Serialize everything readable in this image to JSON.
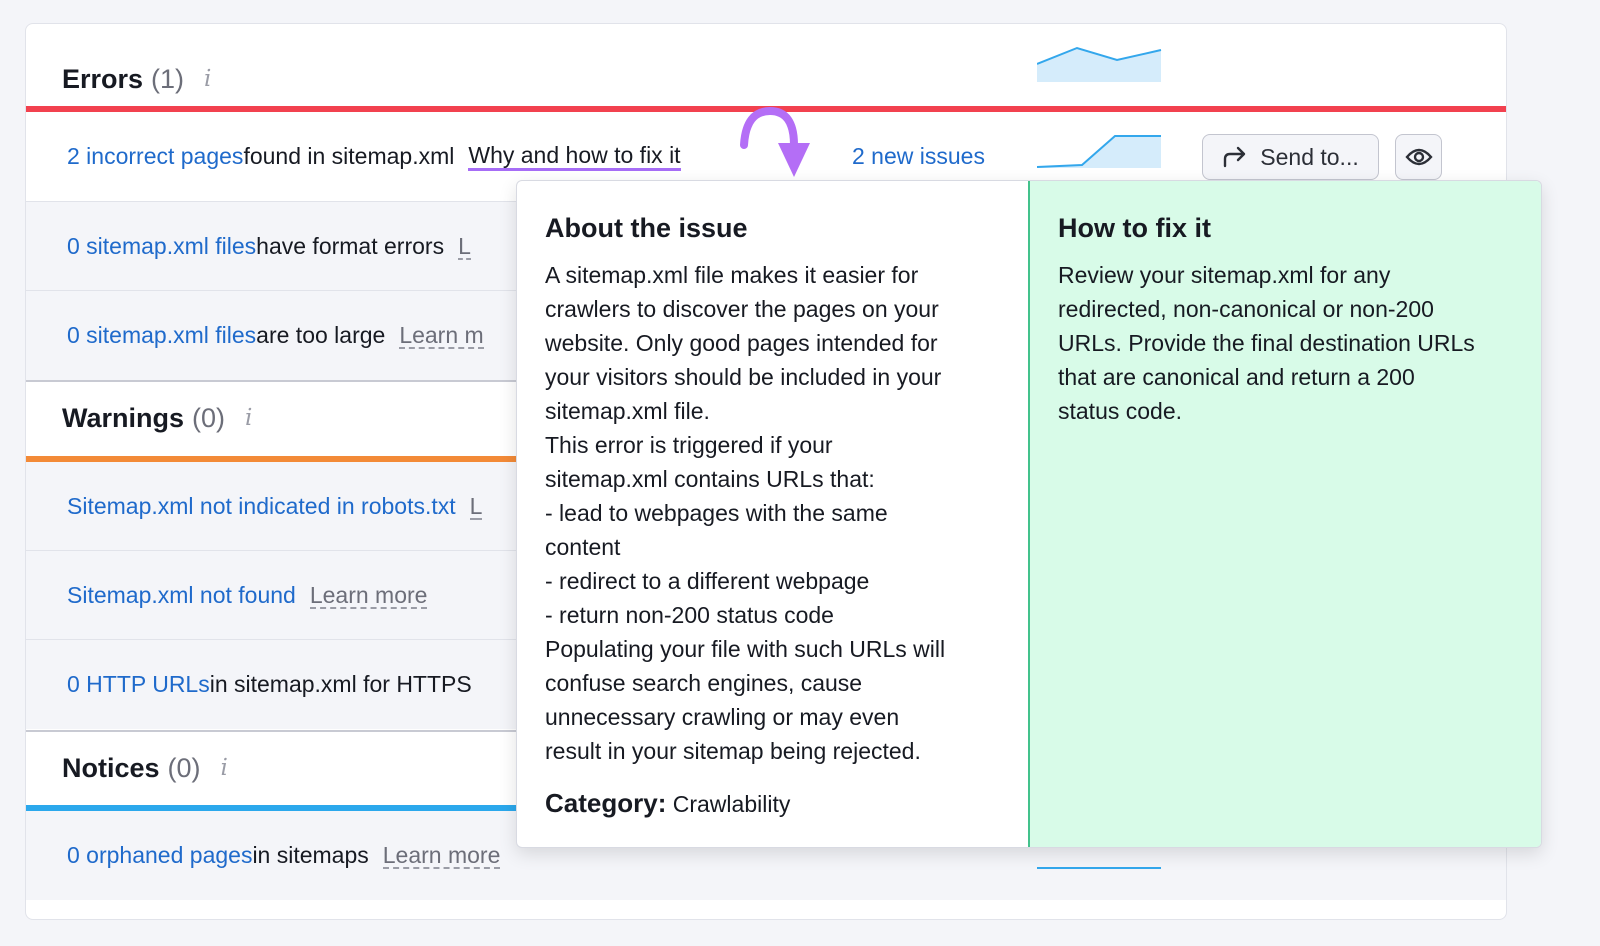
{
  "errors": {
    "title": "Errors",
    "count": "(1)",
    "info": "i"
  },
  "warnings": {
    "title": "Warnings",
    "count": "(0)",
    "info": "i"
  },
  "notices": {
    "title": "Notices",
    "count": "(0)",
    "info": "i"
  },
  "colors": {
    "errors_bar": "#f2414f",
    "warnings_bar": "#f38a37",
    "notices_bar": "#2ba8ec",
    "link": "#1f6acb",
    "popup_fix_bg": "#d8fbe8",
    "arrow": "#b46ef6"
  },
  "rows": {
    "r1": {
      "link": "2 incorrect pages",
      "text": " found in sitemap.xml",
      "why": "Why and how to fix it",
      "new_issues": "2 new issues"
    },
    "r2": {
      "link": "0 sitemap.xml files",
      "text": " have format errors",
      "learn": "L"
    },
    "r3": {
      "link": "0 sitemap.xml files",
      "text": " are too large",
      "learn": "Learn m"
    },
    "r4": {
      "link": "Sitemap.xml not indicated in robots.txt",
      "learn": "L"
    },
    "r5": {
      "link": "Sitemap.xml not found",
      "learn": "Learn more"
    },
    "r6": {
      "link": "0 HTTP URLs",
      "text": " in sitemap.xml for HTTPS"
    },
    "r7": {
      "link": "0 orphaned pages",
      "text": " in sitemaps",
      "learn": "Learn more"
    }
  },
  "buttons": {
    "send_to": "Send to...",
    "send_icon": "share-arrow-icon",
    "eye_icon": "eye-icon"
  },
  "popup": {
    "about_title": "About the issue",
    "about_text": "A sitemap.xml file makes it easier for\ncrawlers to discover the pages on your\nwebsite. Only good pages intended for\nyour visitors should be included in your\nsitemap.xml file.\nThis error is triggered if your\nsitemap.xml contains URLs that:\n- lead to webpages with the same\ncontent\n- redirect to a different webpage\n- return non-200 status code\nPopulating your file with such URLs will\nconfuse search engines, cause\nunnecessary crawling or may even\nresult in your sitemap being rejected.",
    "category_label": "Category:",
    "category_value": " Crawlability",
    "fix_title": "How to fix it",
    "fix_text": "Review your sitemap.xml for any\nredirected, non-canonical or non-200\nURLs. Provide the final destination URLs\nthat are canonical and return a 200\nstatus code."
  }
}
